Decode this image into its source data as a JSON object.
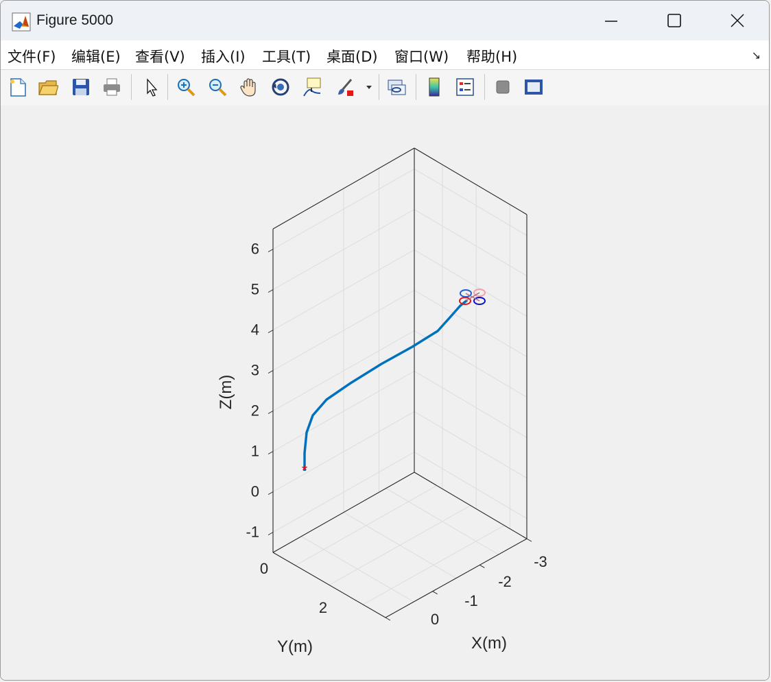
{
  "window": {
    "title": "Figure 5000"
  },
  "menu": [
    {
      "label": "文件(F)"
    },
    {
      "label": "编辑(E)"
    },
    {
      "label": "查看(V)"
    },
    {
      "label": "插入(I)"
    },
    {
      "label": "工具(T)"
    },
    {
      "label": "桌面(D)"
    },
    {
      "label": "窗口(W)"
    },
    {
      "label": "帮助(H)"
    }
  ],
  "toolbar": [
    "new-figure-icon",
    "open-file-icon",
    "save-icon",
    "print-icon",
    "edit-plot-arrow-icon",
    "zoom-in-icon",
    "zoom-out-icon",
    "pan-hand-icon",
    "rotate-3d-icon",
    "data-cursor-icon",
    "brush-icon",
    "link-plot-icon",
    "colorbar-icon",
    "legend-icon",
    "hide-plot-tools-icon",
    "show-plot-tools-icon"
  ],
  "chart_data": {
    "type": "line",
    "dimensions": 3,
    "xlabel": "X(m)",
    "ylabel": "Y(m)",
    "zlabel": "Z(m)",
    "x_ticks": [
      "-3",
      "-2",
      "-1",
      "0"
    ],
    "y_ticks": [
      "0",
      "2"
    ],
    "z_ticks": [
      "-1",
      "0",
      "1",
      "2",
      "3",
      "4",
      "5",
      "6"
    ],
    "zlim": [
      -1.5,
      6.5
    ],
    "grid": true,
    "series": [
      {
        "style": "line",
        "color": "#0072BD",
        "points": [
          {
            "x": 0.0,
            "y": 2.0,
            "z": 0.0
          },
          {
            "x": 0.0,
            "y": 2.0,
            "z": 0.6
          },
          {
            "x": -0.2,
            "y": 2.0,
            "z": 1.4
          },
          {
            "x": -0.8,
            "y": 2.0,
            "z": 2.3
          },
          {
            "x": -1.6,
            "y": 2.0,
            "z": 3.0
          },
          {
            "x": -2.3,
            "y": 2.0,
            "z": 3.8
          },
          {
            "x": -2.8,
            "y": 2.0,
            "z": 4.6
          }
        ]
      }
    ],
    "start_marker": {
      "symbol": "*",
      "color": "#ff0000"
    },
    "quadrotor_rotors": [
      {
        "color": "#1f5fd6"
      },
      {
        "color": "#f4a0a8"
      },
      {
        "color": "#e01a1a"
      },
      {
        "color": "#0c10c8"
      }
    ]
  }
}
